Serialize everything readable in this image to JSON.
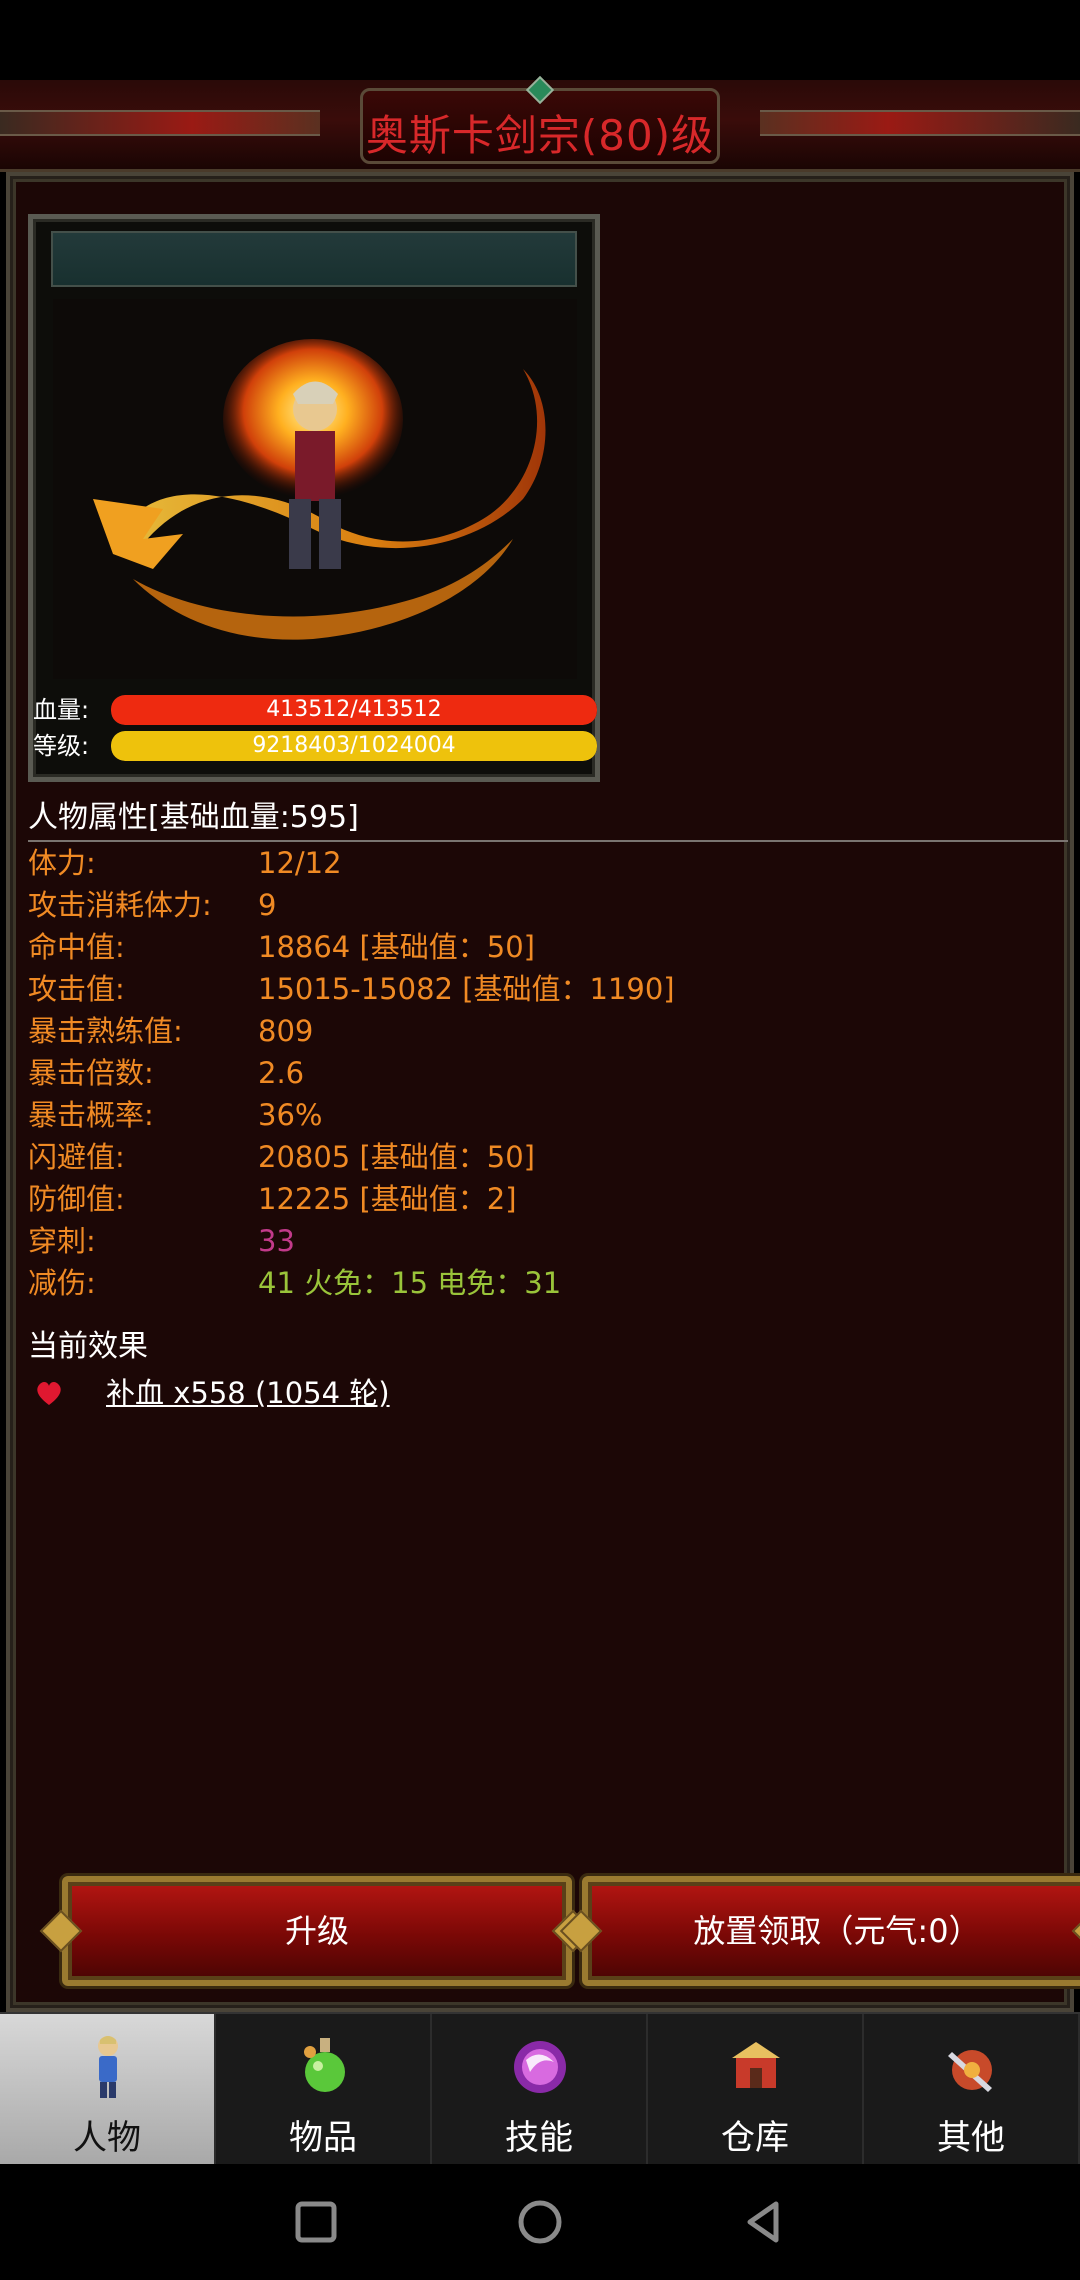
{
  "header": {
    "title": "奥斯卡剑宗(80)级"
  },
  "character": {
    "hp": {
      "label": "血量:",
      "text": "413512/413512",
      "fraction": 1.0,
      "color": "#ee2a10"
    },
    "level": {
      "label": "等级:",
      "text": "9218403/1024004",
      "fraction": 1.0,
      "color": "#eec20c"
    }
  },
  "attributes": {
    "heading": "人物属性[基础血量:595]",
    "rows": [
      {
        "label": "体力:",
        "value": "12/12",
        "color": "#f08a24"
      },
      {
        "label": "攻击消耗体力:",
        "value": "9",
        "color": "#f08a24"
      },
      {
        "label": "命中值:",
        "value": "18864 [基础值：50]",
        "color": "#f08a24"
      },
      {
        "label": "攻击值:",
        "value": "15015-15082 [基础值：1190]",
        "color": "#f08a24"
      },
      {
        "label": "暴击熟练值:",
        "value": "809",
        "color": "#f08a24"
      },
      {
        "label": "暴击倍数:",
        "value": "2.6",
        "color": "#f08a24"
      },
      {
        "label": "暴击概率:",
        "value": "36%",
        "color": "#f08a24"
      },
      {
        "label": "闪避值:",
        "value": "20805 [基础值：50]",
        "color": "#f08a24"
      },
      {
        "label": "防御值:",
        "value": "12225 [基础值：2]",
        "color": "#f08a24"
      },
      {
        "label": "穿刺:",
        "value": "33",
        "color": "#c23a8a"
      },
      {
        "label": "减伤:",
        "value": "41 火免：15 电免：31",
        "color": "#9ac43a"
      }
    ]
  },
  "effects": {
    "heading": "当前效果",
    "items": [
      {
        "icon": "heart-icon",
        "text": "补血 x558 (1054 轮)"
      }
    ]
  },
  "actions": {
    "upgrade_label": "升级",
    "idle_claim_label": "放置领取（元气:0）"
  },
  "tabs": [
    {
      "label": "人物",
      "icon": "character-icon",
      "active": true
    },
    {
      "label": "物品",
      "icon": "potion-icon",
      "active": false
    },
    {
      "label": "技能",
      "icon": "skill-orb-icon",
      "active": false
    },
    {
      "label": "仓库",
      "icon": "warehouse-icon",
      "active": false
    },
    {
      "label": "其他",
      "icon": "other-icon",
      "active": false
    }
  ],
  "colors": {
    "title_red": "#d8282a",
    "attribute_orange": "#f08a24",
    "pierce_magenta": "#c23a8a",
    "reduction_green": "#9ac43a"
  }
}
